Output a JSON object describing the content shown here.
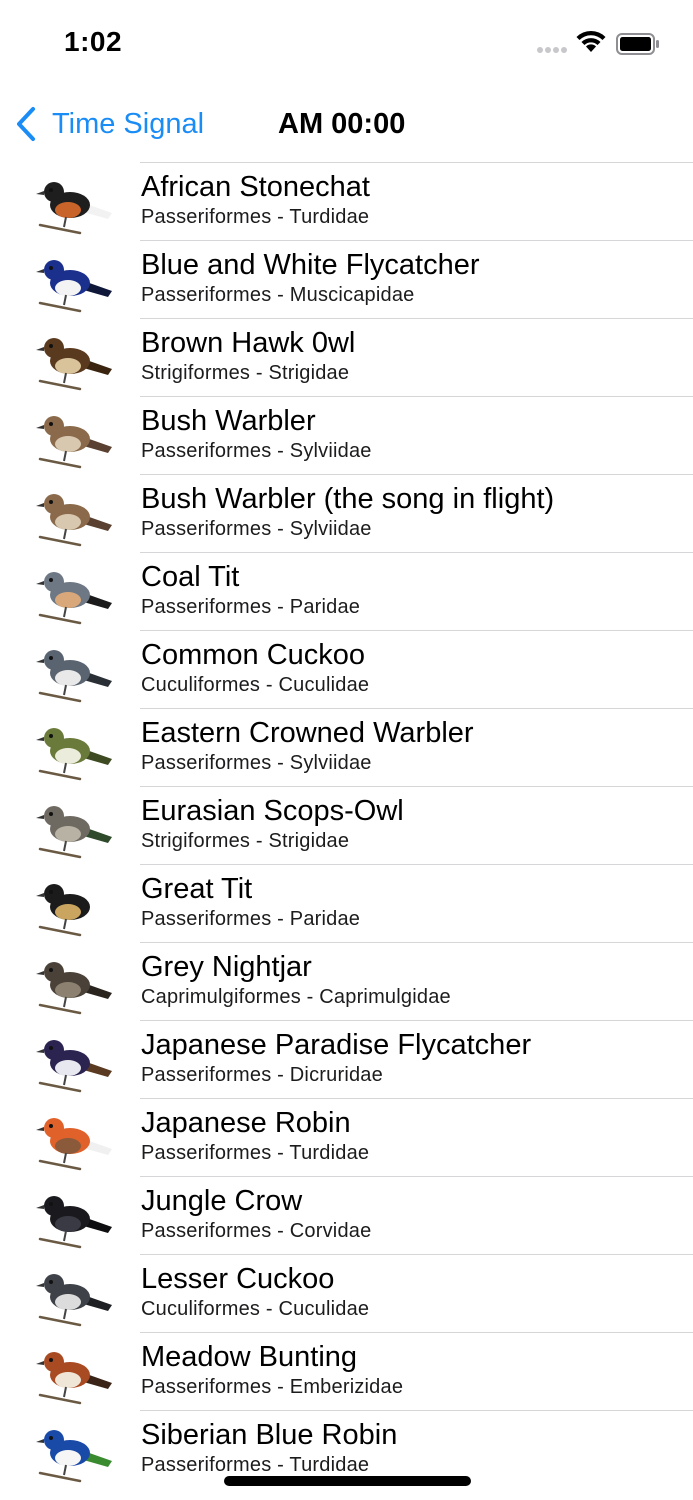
{
  "status_bar": {
    "time": "1:02"
  },
  "nav": {
    "back_label": "Time Signal",
    "title": "AM 00:00"
  },
  "birds": [
    {
      "name": "African Stonechat",
      "classification": "Passeriformes - Turdidae",
      "icon": "african-stonechat-icon",
      "colors": [
        "#1e1e1e",
        "#c8642a",
        "#f2f2f2"
      ]
    },
    {
      "name": "Blue and White Flycatcher",
      "classification": "Passeriformes - Muscicapidae",
      "icon": "blue-white-flycatcher-icon",
      "colors": [
        "#1b2f8c",
        "#f4f4f4",
        "#10183a"
      ]
    },
    {
      "name": "Brown Hawk 0wl",
      "classification": "Strigiformes - Strigidae",
      "icon": "brown-hawk-owl-icon",
      "colors": [
        "#5a3a1e",
        "#d9c39a",
        "#3a2410"
      ]
    },
    {
      "name": "Bush Warbler",
      "classification": "Passeriformes - Sylviidae",
      "icon": "bush-warbler-icon",
      "colors": [
        "#8a6a4a",
        "#d8c8b0",
        "#5a4030"
      ]
    },
    {
      "name": "Bush Warbler (the song in flight)",
      "classification": "Passeriformes - Sylviidae",
      "icon": "bush-warbler-flight-icon",
      "colors": [
        "#8a6a4a",
        "#d8c8b0",
        "#5a4030"
      ]
    },
    {
      "name": "Coal Tit",
      "classification": "Passeriformes - Paridae",
      "icon": "coal-tit-icon",
      "colors": [
        "#6e7884",
        "#d9a87a",
        "#1b1b1b"
      ]
    },
    {
      "name": "Common Cuckoo",
      "classification": "Cuculiformes - Cuculidae",
      "icon": "common-cuckoo-icon",
      "colors": [
        "#5a6470",
        "#e9e9e9",
        "#2a2f36"
      ]
    },
    {
      "name": "Eastern Crowned Warbler",
      "classification": "Passeriformes - Sylviidae",
      "icon": "eastern-crowned-warbler-icon",
      "colors": [
        "#6a7a3a",
        "#ececdc",
        "#3e4a22"
      ]
    },
    {
      "name": "Eurasian Scops-Owl",
      "classification": "Strigiformes - Strigidae",
      "icon": "eurasian-scops-owl-icon",
      "colors": [
        "#6e6a62",
        "#b8b2a4",
        "#2e4a2a"
      ]
    },
    {
      "name": "Great Tit",
      "classification": "Passeriformes - Paridae",
      "icon": "great-tit-icon",
      "colors": [
        "#1b1b1b",
        "#c9a560",
        "#ffffff"
      ]
    },
    {
      "name": "Grey Nightjar",
      "classification": "Caprimulgiformes - Caprimulgidae",
      "icon": "grey-nightjar-icon",
      "colors": [
        "#4a4238",
        "#8c8070",
        "#2a241e"
      ]
    },
    {
      "name": "Japanese Paradise Flycatcher",
      "classification": "Passeriformes - Dicruridae",
      "icon": "japanese-paradise-flycatcher-icon",
      "colors": [
        "#2c2450",
        "#e8e8f0",
        "#5a3a20"
      ]
    },
    {
      "name": "Japanese Robin",
      "classification": "Passeriformes - Turdidae",
      "icon": "japanese-robin-icon",
      "colors": [
        "#e0622a",
        "#8a5a3a",
        "#f0f0f0"
      ]
    },
    {
      "name": "Jungle Crow",
      "classification": "Passeriformes - Corvidae",
      "icon": "jungle-crow-icon",
      "colors": [
        "#1a1a1e",
        "#3a3a44",
        "#0e0e10"
      ]
    },
    {
      "name": "Lesser Cuckoo",
      "classification": "Cuculiformes - Cuculidae",
      "icon": "lesser-cuckoo-icon",
      "colors": [
        "#3e4248",
        "#dcdcdc",
        "#1e2024"
      ]
    },
    {
      "name": "Meadow Bunting",
      "classification": "Passeriformes - Emberizidae",
      "icon": "meadow-bunting-icon",
      "colors": [
        "#a84a22",
        "#f0e6d8",
        "#3a2418"
      ]
    },
    {
      "name": "Siberian Blue Robin",
      "classification": "Passeriformes - Turdidae",
      "icon": "siberian-blue-robin-icon",
      "colors": [
        "#1a4aa8",
        "#f6f6f6",
        "#3a8a30"
      ]
    }
  ]
}
